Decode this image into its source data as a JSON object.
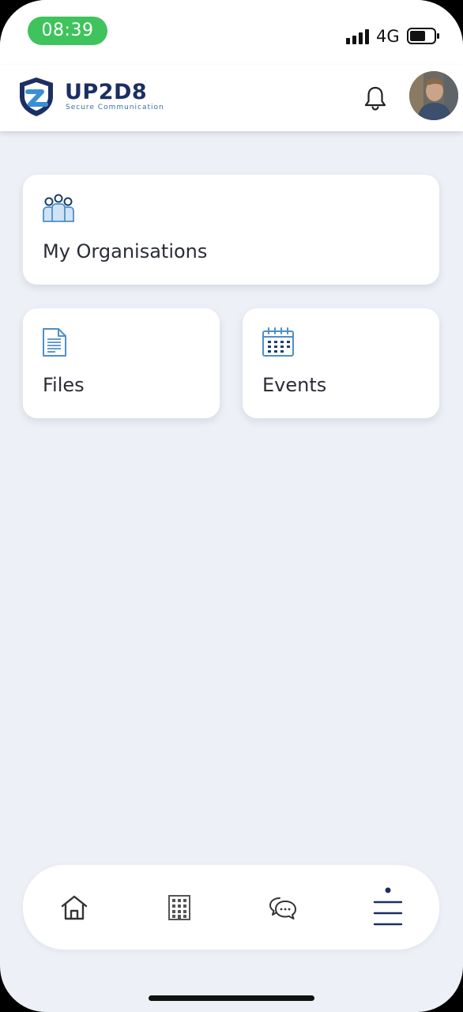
{
  "status_bar": {
    "time": "08:39",
    "network": "4G"
  },
  "header": {
    "brand_name": "UP2D8",
    "brand_tagline": "Secure Communication"
  },
  "cards": {
    "organisations_label": "My Organisations",
    "files_label": "Files",
    "events_label": "Events"
  },
  "icons": {
    "organisations": "people-group-icon",
    "files": "document-icon",
    "events": "calendar-icon",
    "notifications": "bell-icon",
    "home": "home-icon",
    "organisation": "building-icon",
    "chat": "chat-bubbles-icon",
    "menu": "menu-icon"
  },
  "colors": {
    "accent": "#1b2f63",
    "icon_blue": "#4f8fc7",
    "status_pill": "#3fc35c",
    "background": "#edf0f6"
  },
  "bottom_nav": {
    "active": "menu"
  }
}
